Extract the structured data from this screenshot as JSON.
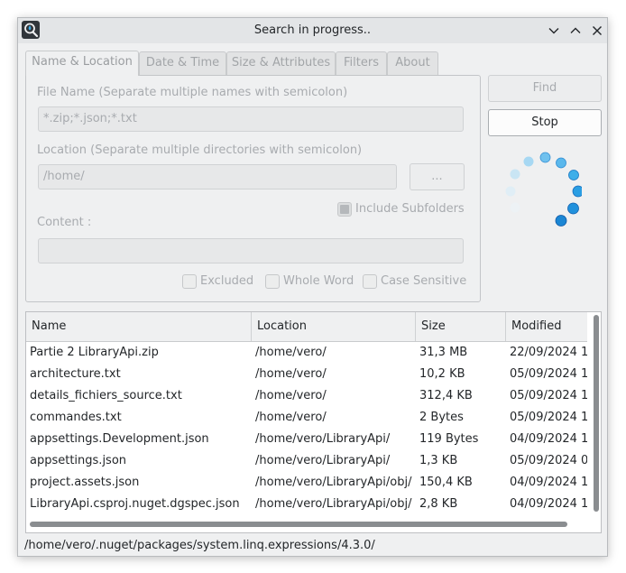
{
  "window": {
    "title": "Search in progress.."
  },
  "tabs": [
    {
      "label": "Name & Location",
      "active": true
    },
    {
      "label": "Date & Time",
      "active": false
    },
    {
      "label": "Size & Attributes",
      "active": false
    },
    {
      "label": "Filters",
      "active": false
    },
    {
      "label": "About",
      "active": false
    }
  ],
  "form": {
    "file_name_label": "File Name (Separate multiple names with semicolon)",
    "file_name_value": "*.zip;*.json;*.txt",
    "location_label": "Location (Separate multiple directories with semicolon)",
    "location_value": "/home/",
    "browse_label": "...",
    "include_subfolders_label": "Include Subfolders",
    "include_subfolders_checked": true,
    "content_label": "Content :",
    "content_value": "",
    "excluded_label": "Excluded",
    "whole_word_label": "Whole Word",
    "case_sensitive_label": "Case Sensitive"
  },
  "buttons": {
    "find_label": "Find",
    "stop_label": "Stop"
  },
  "table": {
    "columns": [
      "Name",
      "Location",
      "Size",
      "Modified"
    ],
    "rows": [
      [
        "Partie 2 LibraryApi.zip",
        "/home/vero/",
        "31,3 MB",
        "22/09/2024 1"
      ],
      [
        "architecture.txt",
        "/home/vero/",
        "10,2 KB",
        "05/09/2024 1"
      ],
      [
        "details_fichiers_source.txt",
        "/home/vero/",
        "312,4 KB",
        "05/09/2024 1"
      ],
      [
        "commandes.txt",
        "/home/vero/",
        "2 Bytes",
        "05/09/2024 1"
      ],
      [
        "appsettings.Development.json",
        "/home/vero/LibraryApi/",
        "119 Bytes",
        "04/09/2024 1"
      ],
      [
        "appsettings.json",
        "/home/vero/LibraryApi/",
        "1,3 KB",
        "05/09/2024 0"
      ],
      [
        "project.assets.json",
        "/home/vero/LibraryApi/obj/",
        "150,4 KB",
        "04/09/2024 1"
      ],
      [
        "LibraryApi.csproj.nuget.dgspec.json",
        "/home/vero/LibraryApi/obj/",
        "2,8 KB",
        "04/09/2024 1"
      ]
    ]
  },
  "status": {
    "path": "/home/vero/.nuget/packages/system.linq.expressions/4.3.0/"
  },
  "colors": {
    "accent": "#3daee9",
    "spinner_dark": "#1d84d1"
  },
  "icons": {
    "app": "search-icon",
    "spinner": "loading-spinner-icon"
  }
}
